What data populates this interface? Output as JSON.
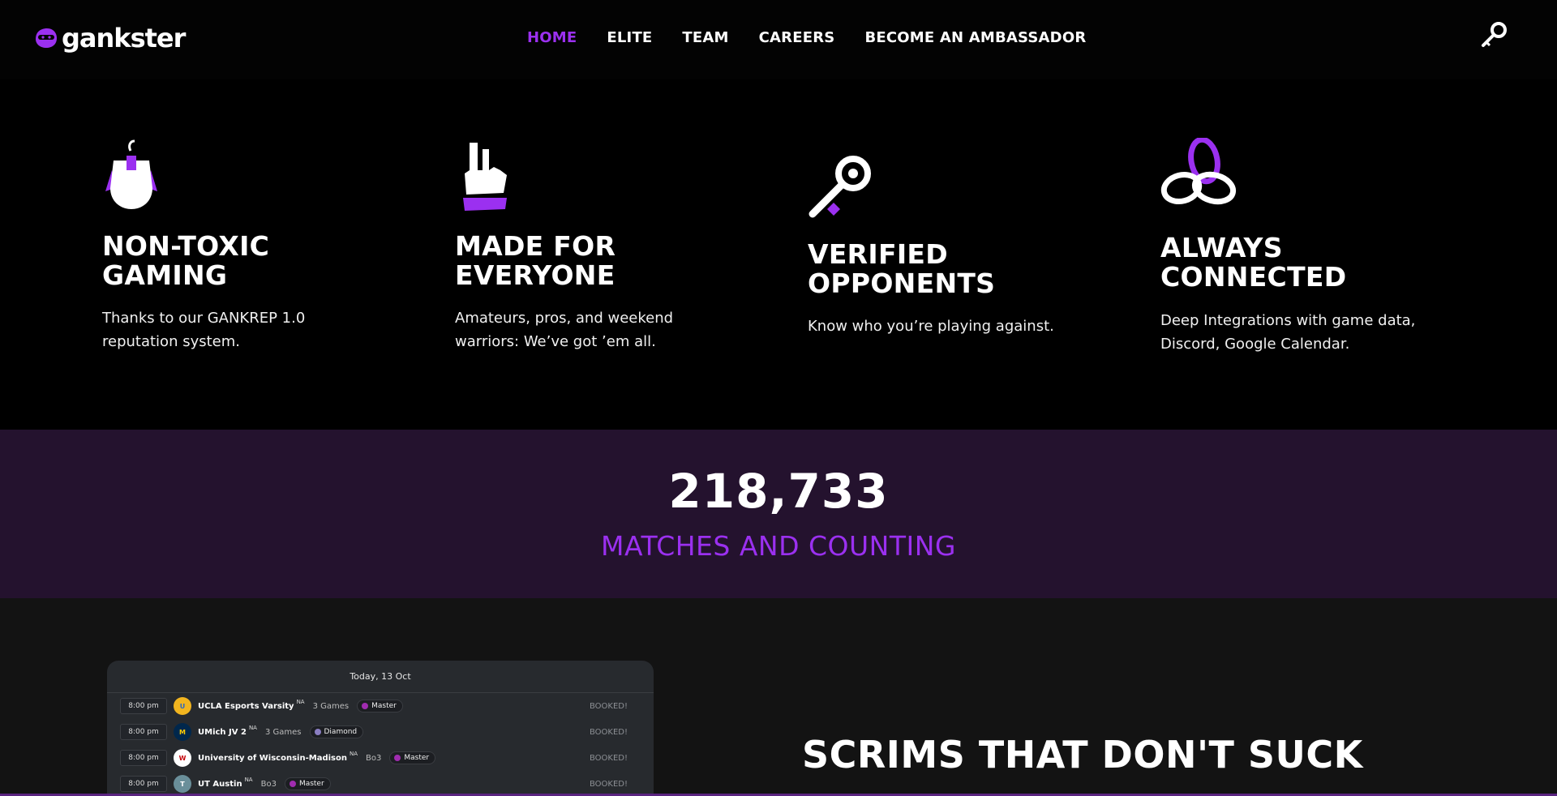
{
  "colors": {
    "accent": "#9b30f0",
    "stats_bg": "#24122e"
  },
  "brand": {
    "name": "gankster",
    "logo_icon": "ninja-mask-icon"
  },
  "nav": {
    "items": [
      {
        "label": "HOME",
        "active": true
      },
      {
        "label": "ELITE"
      },
      {
        "label": "TEAM"
      },
      {
        "label": "CAREERS"
      },
      {
        "label": "BECOME AN AMBASSADOR"
      }
    ],
    "login_icon": "key-icon"
  },
  "features": [
    {
      "icon": "mouse-icon",
      "title": "NON-TOXIC\nGAMING",
      "text": "Thanks to our GANKREP 1.0 reputation system."
    },
    {
      "icon": "hand-gesture-icon",
      "title": "MADE FOR\nEVERYONE",
      "text": "Amateurs, pros, and weekend warriors: We’ve got ’em all."
    },
    {
      "icon": "key-icon",
      "title": "VERIFIED\nOPPONENTS",
      "text": "Know who you’re playing against."
    },
    {
      "icon": "interlocked-rings-icon",
      "title": "ALWAYS\nCONNECTED",
      "text": "Deep Integrations with game data, Discord, Google Calendar."
    }
  ],
  "stats": {
    "number": "218,733",
    "label": "MATCHES AND COUNTING"
  },
  "schedule": {
    "date": "Today, 13 Oct",
    "rows": [
      {
        "time": "8:00 pm",
        "team": "UCLA Esports Varsity",
        "region": "NA",
        "format": "3 Games",
        "rank": "Master",
        "status": "BOOKED!"
      },
      {
        "time": "8:00 pm",
        "team": "UMich JV 2",
        "region": "NA",
        "format": "3 Games",
        "rank": "Diamond",
        "status": "BOOKED!"
      },
      {
        "time": "8:00 pm",
        "team": "University of Wisconsin-Madison",
        "region": "NA",
        "format": "Bo3",
        "rank": "Master",
        "status": "BOOKED!"
      },
      {
        "time": "8:00 pm",
        "team": "UT Austin",
        "region": "NA",
        "format": "Bo3",
        "rank": "Master",
        "status": "BOOKED!"
      }
    ]
  },
  "scrims": {
    "title_strong": "SCRIMS",
    "title_rest": " THAT DON'T SUCK"
  }
}
